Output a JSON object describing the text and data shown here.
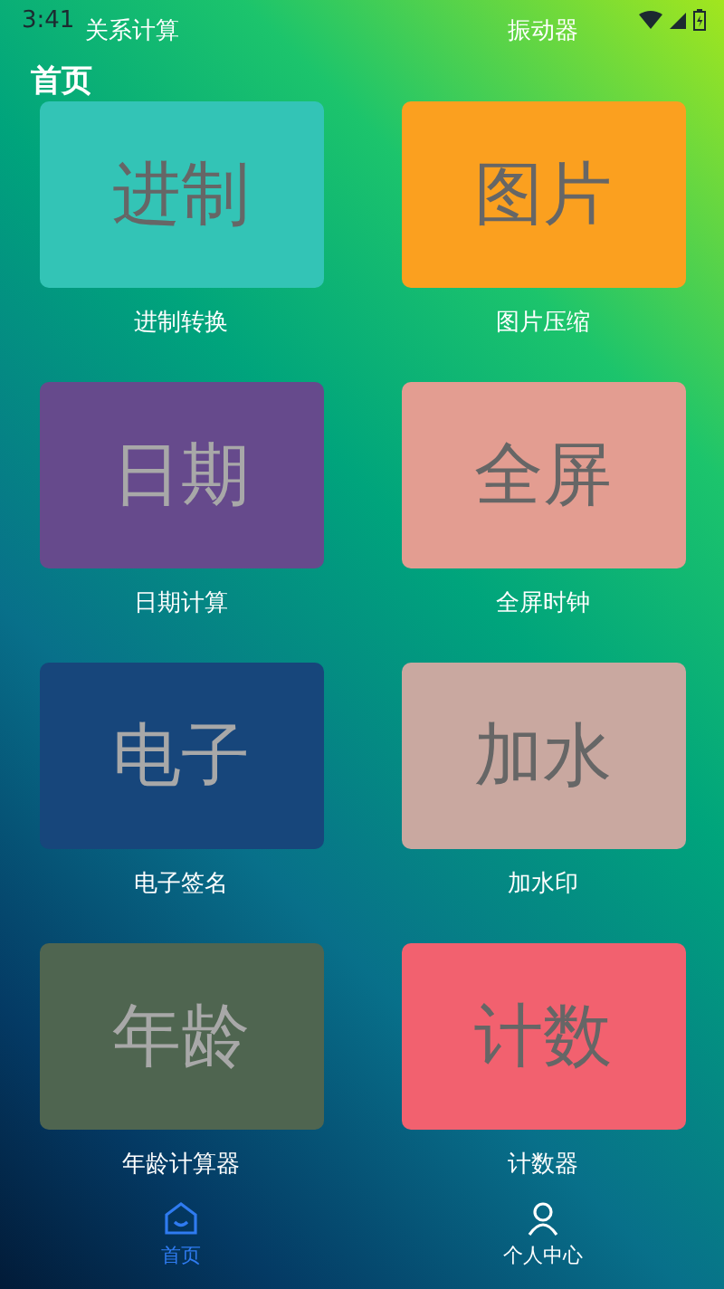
{
  "status_bar": {
    "time": "3:41"
  },
  "header_items": [
    "关系计算",
    "振动器"
  ],
  "title": "首页",
  "tiles": [
    {
      "text": "进制",
      "label": "进制转换",
      "color": "#33c4b6"
    },
    {
      "text": "图片",
      "label": "图片压缩",
      "color": "#fba01f"
    },
    {
      "text": "日期",
      "label": "日期计算",
      "color": "#664a8c"
    },
    {
      "text": "全屏",
      "label": "全屏时钟",
      "color": "#e39d91"
    },
    {
      "text": "电子",
      "label": "电子签名",
      "color": "#17467b"
    },
    {
      "text": "加水",
      "label": "加水印",
      "color": "#c9a8a0"
    },
    {
      "text": "年龄",
      "label": "年龄计算器",
      "color": "#4f6550"
    },
    {
      "text": "计数",
      "label": "计数器",
      "color": "#f2616f"
    }
  ],
  "bottom_nav": [
    {
      "kind": "home",
      "label": "首页",
      "selected": true
    },
    {
      "kind": "person",
      "label": "个人中心",
      "selected": false
    }
  ]
}
